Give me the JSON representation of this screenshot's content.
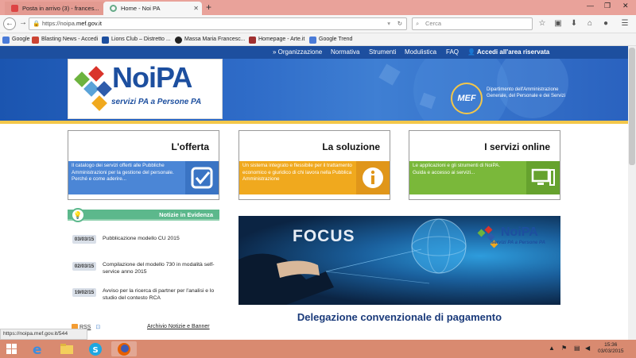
{
  "browser": {
    "tabs": [
      {
        "title": "Posta in arrivo (3) - frances..."
      },
      {
        "title": "Home - Noi PA"
      }
    ],
    "url_prefix": "https://noipa.",
    "url_domain": "mef.gov.it",
    "search_placeholder": "Cerca",
    "new_tab_label": "+",
    "bookmarks": [
      {
        "label": "Google",
        "color": "#4a7bd8"
      },
      {
        "label": "Blasting News - Accedi",
        "color": "#c43"
      },
      {
        "label": "Lions Club – Distretto ...",
        "color": "#1d4f9f"
      },
      {
        "label": "Massa Maria Francesc...",
        "color": "#222"
      },
      {
        "label": "Homepage - Arte.it",
        "color": "#a03030"
      },
      {
        "label": "Google Trend",
        "color": "#4a7bd8"
      }
    ]
  },
  "site": {
    "topnav": [
      "Organizzazione",
      "Normativa",
      "Strumenti",
      "Modulistica",
      "FAQ"
    ],
    "login_label": "Accedi all'area riservata",
    "brand": "NoiPA",
    "brand_sub": "servizi PA a Persone PA",
    "mef_logo": "MEF",
    "mef_text": "Dipartimento dell'Amministrazione Generale, del Personale e dei Servizi"
  },
  "boxes": [
    {
      "title": "L'offerta",
      "text": "Il catalogo dei servizi offerti alle Pubbliche Amministrazioni per la gestione del personale.\nPerché e come aderire...",
      "bg": "#4b86d6",
      "icon": "check-icon"
    },
    {
      "title": "La soluzione",
      "text": "Un sistema integrato e flessibile per il trattamento economico e giuridico di chi lavora nella Pubblica Amministrazione",
      "bg": "#f0a91e",
      "icon": "info-icon"
    },
    {
      "title": "I servizi online",
      "text": "Le applicazioni e gli strumenti di NoiPA.\nGuida e accesso ai servizi...",
      "bg": "#7ab83a",
      "icon": "computer-icon"
    }
  ],
  "news": {
    "header": "Notizie in Evidenza",
    "items": [
      {
        "date": "03/03/15",
        "text": "Pubblicazione modello CU 2015"
      },
      {
        "date": "02/03/15",
        "text": "Compilazione del modello 730 in modalità self-service anno 2015"
      },
      {
        "date": "19/02/15",
        "text": "Avviso per la ricerca di partner per l'analisi e lo studio del contesto RCA"
      }
    ],
    "rss": "RSS",
    "archive": "Archivio Notizie e Banner"
  },
  "focus": {
    "label": "FOCUS",
    "logo": "NoiPA",
    "logo_sub": "servizi PA a Persone PA",
    "caption": "Delegazione convenzionale di pagamento"
  },
  "status_url": "https://noipa.mef.gov.it/544",
  "clock": {
    "time": "15:36",
    "date": "03/03/2015"
  }
}
